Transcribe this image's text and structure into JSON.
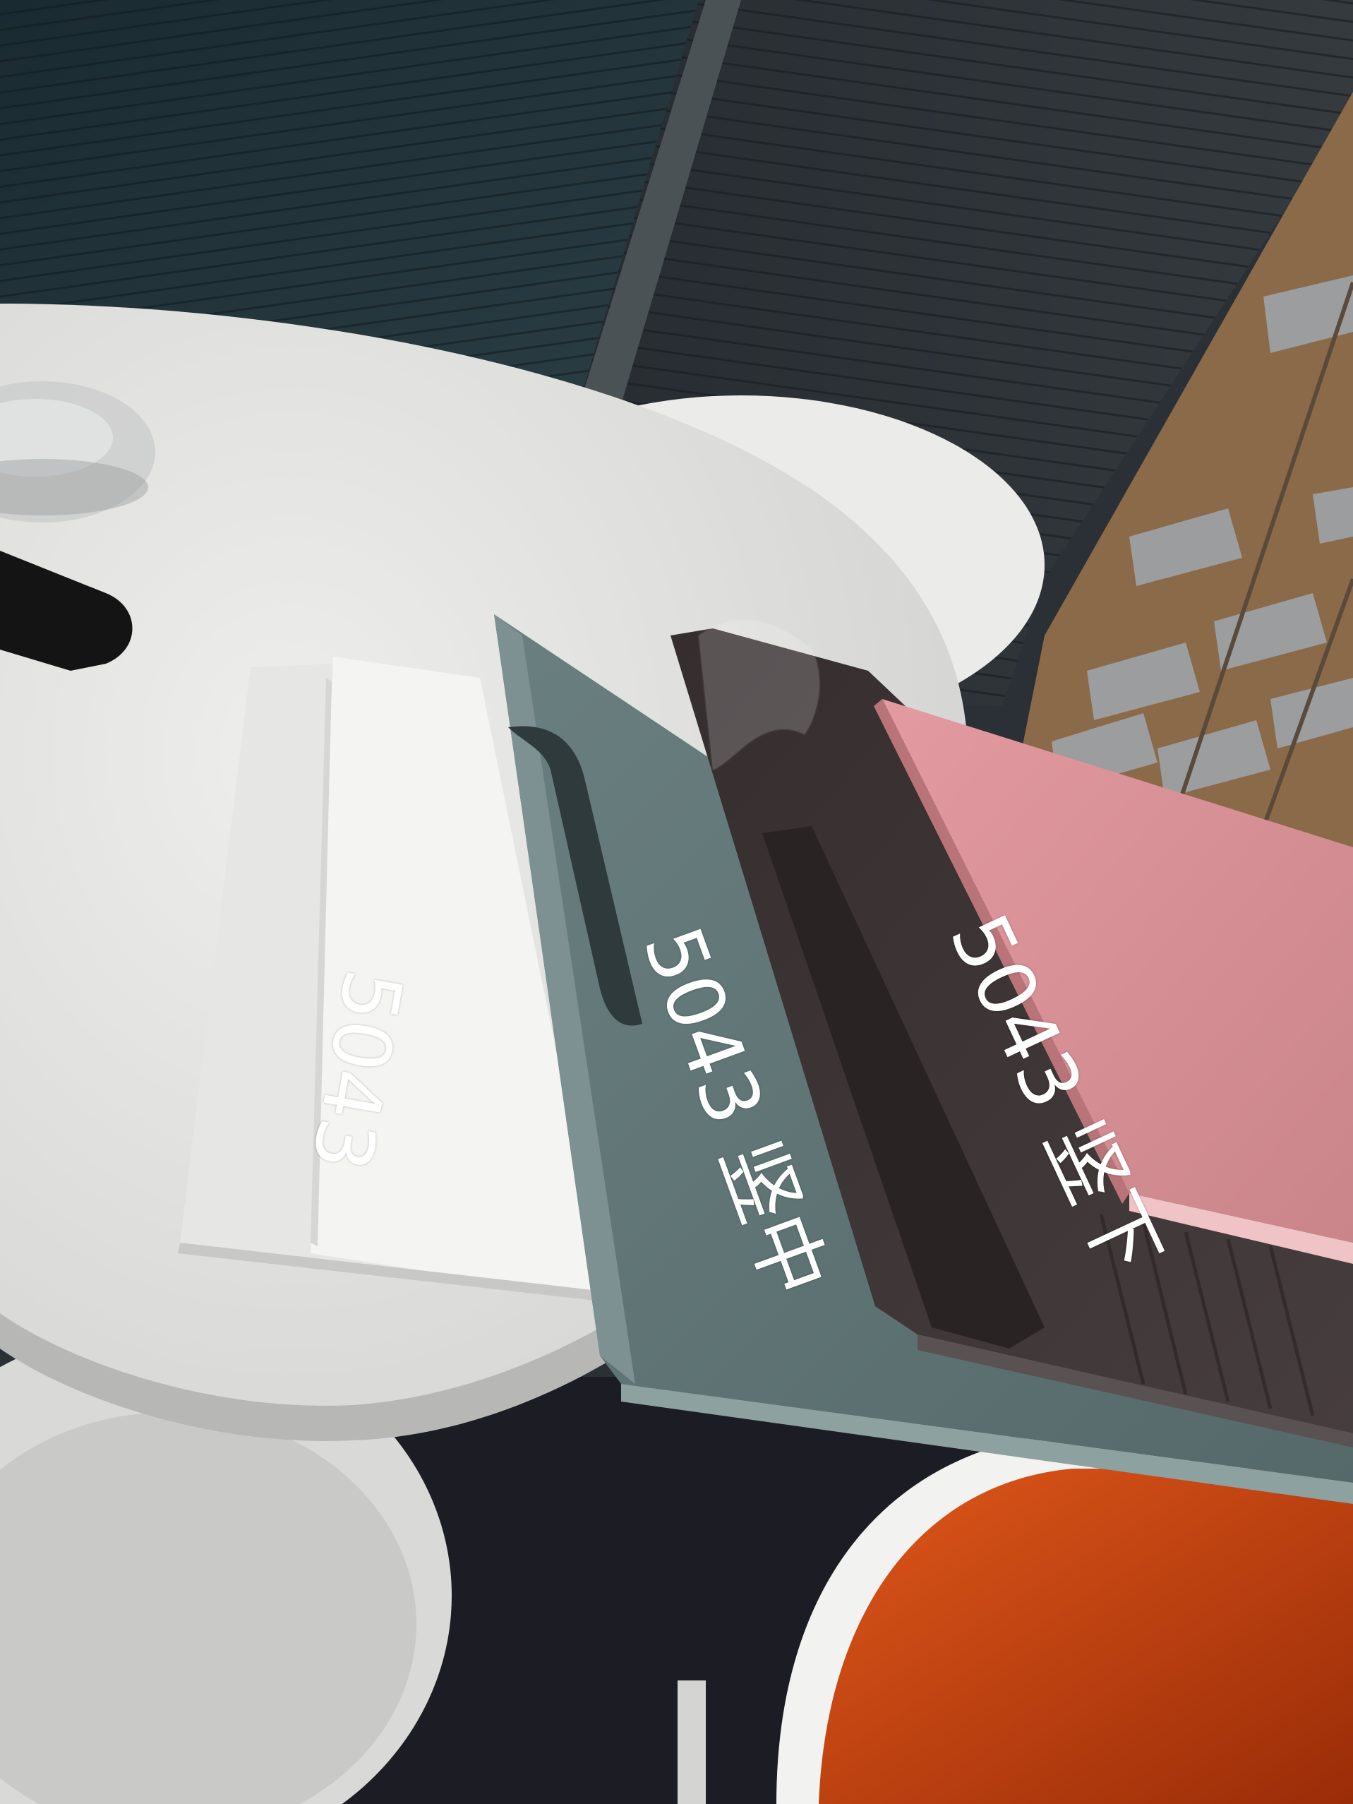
{
  "photo": {
    "subject": "cabinet-door-handle-samples",
    "colors": {
      "blinds_left": "#1f2f36",
      "blinds_right": "#2a3236",
      "table_top": "#e4e4e2",
      "white_panel": "#f2f2f1",
      "teal_panel": "#5f7474",
      "dark_panel": "#3a3233",
      "pink_panel": "#d98c92",
      "orange_chair": "#d24a10",
      "floor": "#1b1c24"
    }
  },
  "labels": {
    "white_sample": "5043",
    "teal_sample": "5043 竖中",
    "dark_sample": "5043 竖下"
  }
}
